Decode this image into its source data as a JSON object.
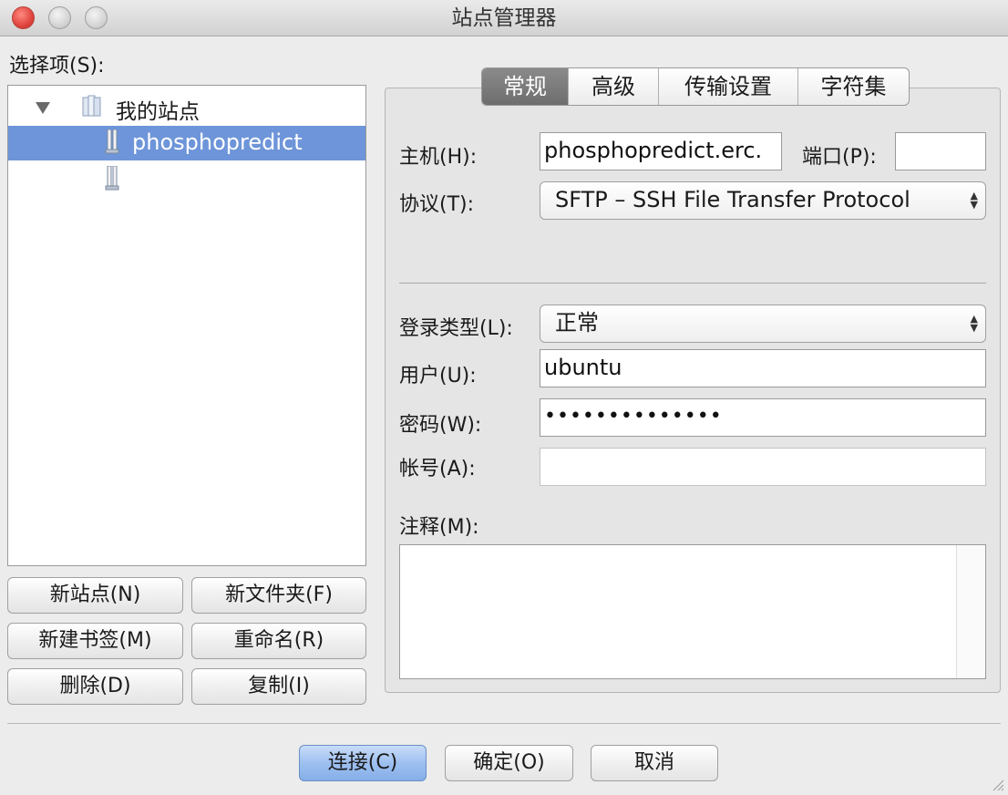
{
  "window": {
    "title": "站点管理器"
  },
  "left": {
    "select_label": "选择项(S):",
    "tree": {
      "root": "我的站点",
      "items": [
        "phosphopredict",
        ""
      ]
    },
    "buttons": {
      "new_site": "新站点(N)",
      "new_folder": "新文件夹(F)",
      "new_bookmark": "新建书签(M)",
      "rename": "重命名(R)",
      "delete": "删除(D)",
      "copy": "复制(I)"
    }
  },
  "tabs": [
    "常规",
    "高级",
    "传输设置",
    "字符集"
  ],
  "general": {
    "host_label": "主机(H):",
    "host_value": "phosphopredict.erc.",
    "port_label": "端口(P):",
    "port_value": "",
    "protocol_label": "协议(T):",
    "protocol_value": "SFTP – SSH File Transfer Protocol",
    "logon_type_label": "登录类型(L):",
    "logon_type_value": "正常",
    "user_label": "用户(U):",
    "user_value": "ubuntu",
    "password_label": "密码(W):",
    "password_value": "••••••••••••••",
    "account_label": "帐号(A):",
    "account_value": "",
    "comments_label": "注释(M):"
  },
  "footer": {
    "connect": "连接(C)",
    "ok": "确定(O)",
    "cancel": "取消"
  },
  "colors": {
    "selection": "#6e95d9",
    "primary_button": "#9ec0f0",
    "active_tab": "#7a7a7a"
  }
}
